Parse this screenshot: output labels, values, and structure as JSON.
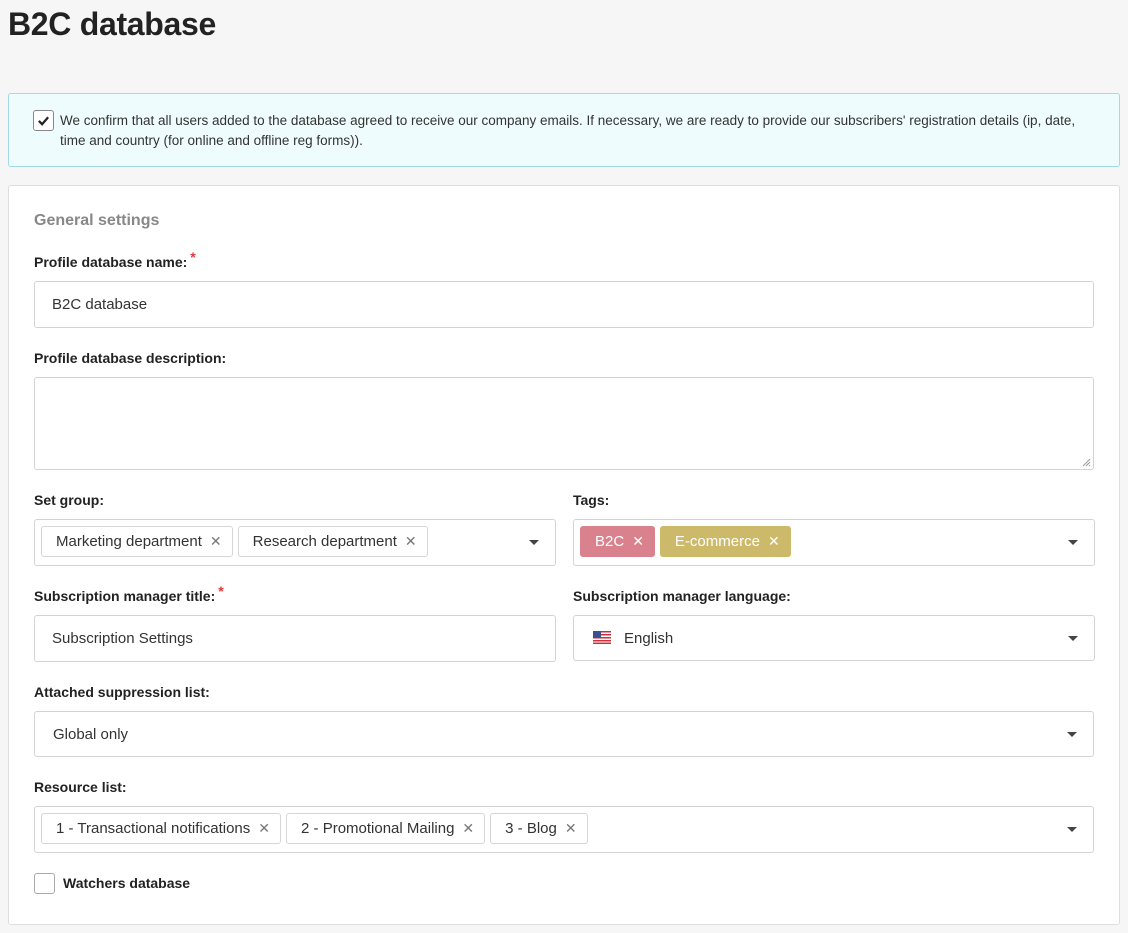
{
  "page": {
    "title": "B2C database"
  },
  "notice": {
    "checked": true,
    "text": "We confirm that all users added to the database agreed to receive our company emails. If necessary, we are ready to provide our subscribers' registration details (ip, date, time and country (for online and offline reg forms))."
  },
  "general": {
    "section_title": "General settings",
    "name_label": "Profile database name:",
    "name_required": "*",
    "name_value": "B2C database",
    "description_label": "Profile database description:",
    "description_value": "",
    "group_label": "Set group:",
    "groups": [
      "Marketing department",
      "Research department"
    ],
    "tags_label": "Tags:",
    "tags": [
      {
        "label": "B2C",
        "color": "#d9828e"
      },
      {
        "label": "E-commerce",
        "color": "#cdb96a"
      }
    ],
    "sm_title_label": "Subscription manager title:",
    "sm_title_required": "*",
    "sm_title_value": "Subscription Settings",
    "sm_language_label": "Subscription manager language:",
    "sm_language_value": "English",
    "sm_language_flag": "us-flag-icon",
    "suppression_label": "Attached suppression list:",
    "suppression_value": "Global only",
    "resource_label": "Resource list:",
    "resources": [
      "1 - Transactional notifications",
      "2 - Promotional Mailing",
      "3 - Blog"
    ],
    "watchers_label": "Watchers database",
    "watchers_checked": false
  },
  "colors": {
    "notice_bg": "#effcfd",
    "notice_border": "#9fdde3",
    "required": "#e4343a"
  }
}
